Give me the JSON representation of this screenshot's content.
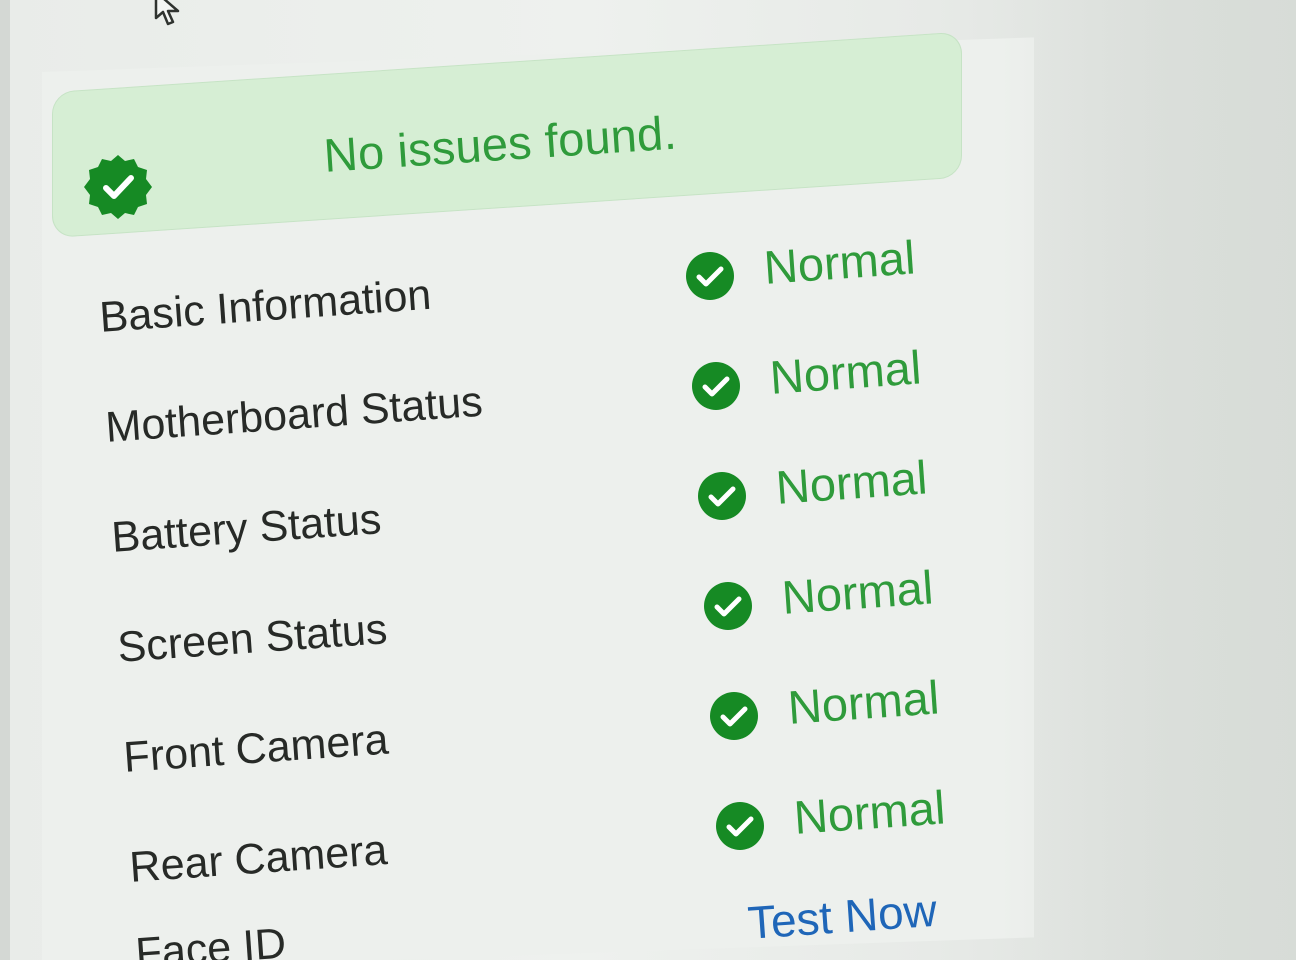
{
  "banner": {
    "message": "No issues found.",
    "icon": "check-badge-icon",
    "color": "#2f9b3b",
    "background": "#d6eed4"
  },
  "checks": [
    {
      "label": "Basic Information",
      "status": "Normal",
      "icon": "check-circle-icon"
    },
    {
      "label": "Motherboard Status",
      "status": "Normal",
      "icon": "check-circle-icon"
    },
    {
      "label": "Battery Status",
      "status": "Normal",
      "icon": "check-circle-icon"
    },
    {
      "label": "Screen Status",
      "status": "Normal",
      "icon": "check-circle-icon"
    },
    {
      "label": "Front Camera",
      "status": "Normal",
      "icon": "check-circle-icon"
    },
    {
      "label": "Rear Camera",
      "status": "Normal",
      "icon": "check-circle-icon"
    },
    {
      "label": "Face ID",
      "action": "Test Now"
    }
  ],
  "colors": {
    "status": "#2f9b3b",
    "icon": "#168a24",
    "action_link": "#1f66b8",
    "text": "#272a27"
  },
  "cursor": {
    "icon": "mouse-pointer-icon"
  }
}
